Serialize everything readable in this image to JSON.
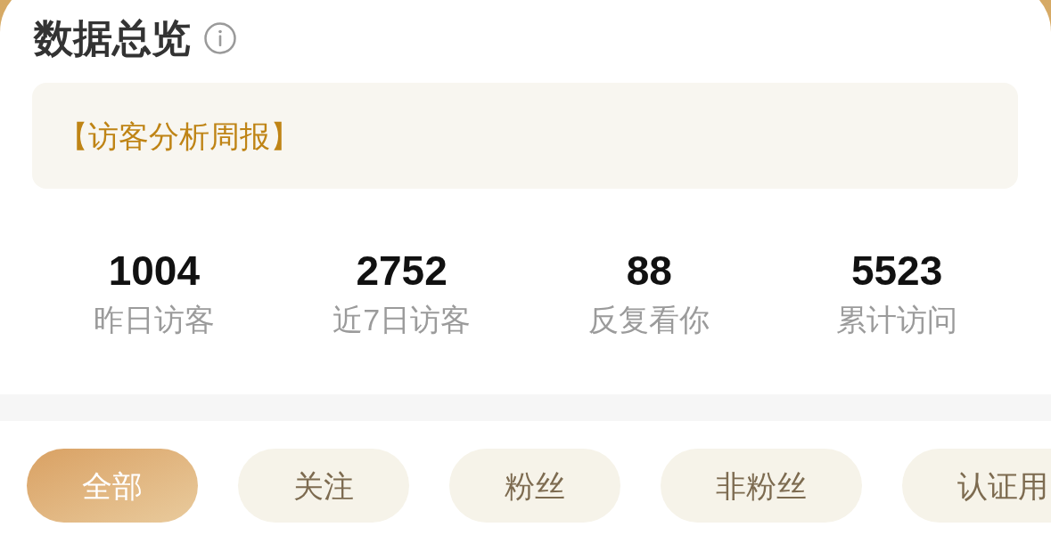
{
  "title": "数据总览",
  "notice": {
    "text": "【访客分析周报】"
  },
  "stats": [
    {
      "value": "1004",
      "label": "昨日访客"
    },
    {
      "value": "2752",
      "label": "近7日访客"
    },
    {
      "value": "88",
      "label": "反复看你"
    },
    {
      "value": "5523",
      "label": "累计访问"
    }
  ],
  "filters": [
    {
      "label": "全部",
      "selected": true
    },
    {
      "label": "关注",
      "selected": false
    },
    {
      "label": "粉丝",
      "selected": false
    },
    {
      "label": "非粉丝",
      "selected": false
    },
    {
      "label": "认证用",
      "selected": false
    }
  ]
}
